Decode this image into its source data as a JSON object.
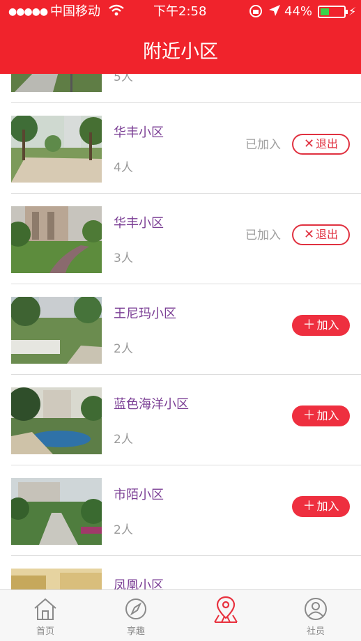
{
  "status_bar": {
    "signal": "●●●●●",
    "carrier": "中国移动",
    "time": "下午2:58",
    "battery_percent": "44%",
    "battery_level": 0.44
  },
  "header": {
    "title": "附近小区"
  },
  "communities": [
    {
      "name": "",
      "members": "5人",
      "status": ""
    },
    {
      "name": "华丰小区",
      "members": "4人",
      "status": "已加入",
      "action": "退出"
    },
    {
      "name": "华丰小区",
      "members": "3人",
      "status": "已加入",
      "action": "退出"
    },
    {
      "name": "王尼玛小区",
      "members": "2人",
      "status": "",
      "action": "加入"
    },
    {
      "name": "蓝色海洋小区",
      "members": "2人",
      "status": "",
      "action": "加入"
    },
    {
      "name": "市陌小区",
      "members": "2人",
      "status": "",
      "action": "加入"
    },
    {
      "name": "凤凰小区",
      "members": "",
      "status": "",
      "action": ""
    }
  ],
  "tabs": [
    {
      "label": "首页",
      "icon": "home-icon"
    },
    {
      "label": "享趣",
      "icon": "compass-icon"
    },
    {
      "label": "",
      "icon": "map-pin-icon",
      "active": true
    },
    {
      "label": "社员",
      "icon": "user-icon"
    }
  ],
  "colors": {
    "brand": "#f0232c",
    "name": "#7a3d94",
    "active_tab": "#e8313e"
  }
}
